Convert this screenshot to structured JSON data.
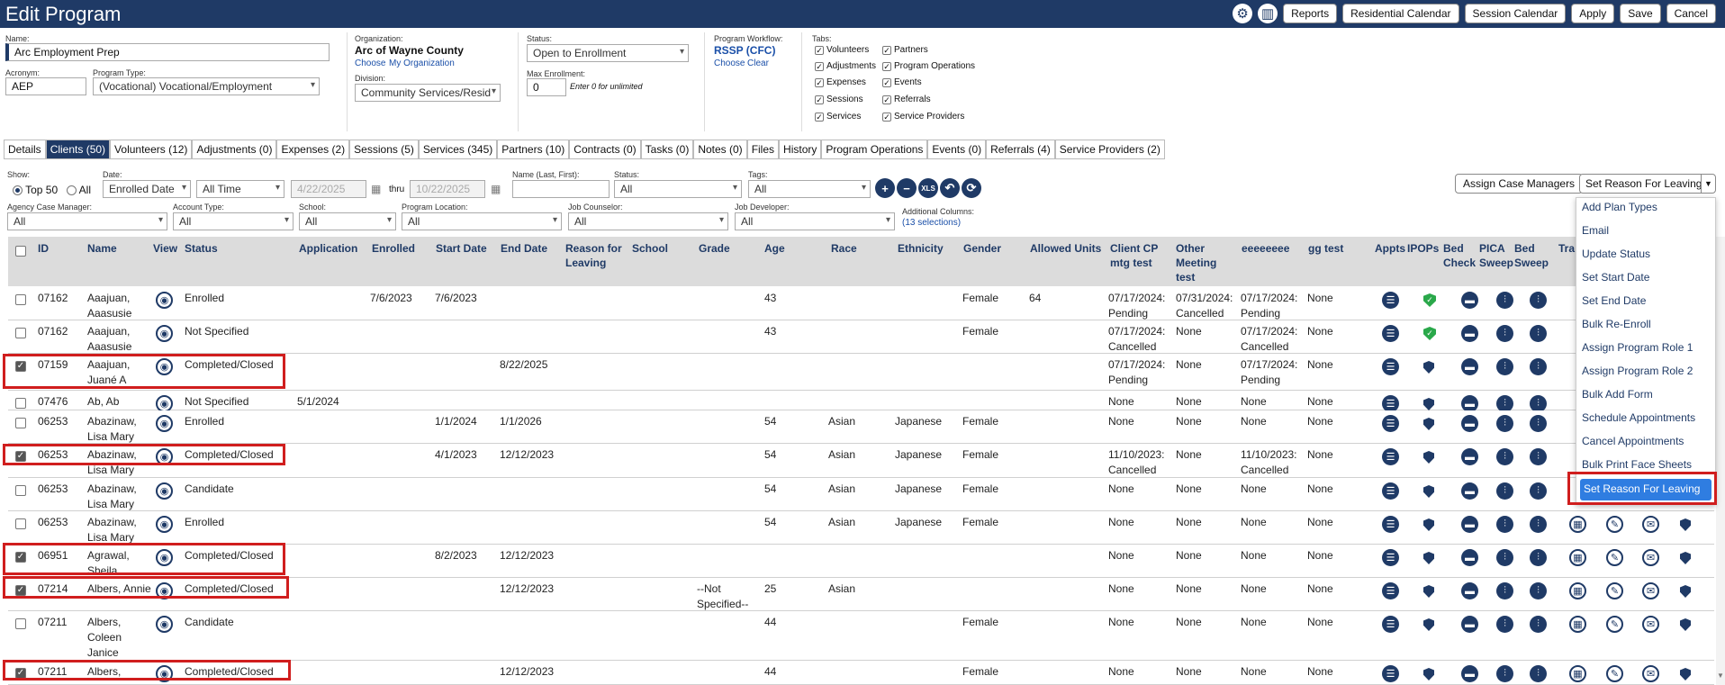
{
  "header": {
    "title": "Edit Program",
    "buttons": [
      "Reports",
      "Residential Calendar",
      "Session Calendar",
      "Apply",
      "Save",
      "Cancel"
    ]
  },
  "form": {
    "name_label": "Name:",
    "name_value": "Arc Employment Prep",
    "acronym_label": "Acronym:",
    "acronym_value": "AEP",
    "program_type_label": "Program Type:",
    "program_type_value": "(Vocational) Vocational/Employment",
    "org_label": "Organization:",
    "org_value": "Arc of Wayne County",
    "org_choose": "Choose",
    "org_mine": "My Organization",
    "division_label": "Division:",
    "division_value": "Community Services/Resid",
    "status_label": "Status:",
    "status_value": "Open to Enrollment",
    "max_label": "Max Enrollment:",
    "max_value": "0",
    "max_hint": "Enter 0 for unlimited",
    "workflow_label": "Program Workflow:",
    "workflow_value": "RSSP (CFC)",
    "workflow_choose": "Choose",
    "workflow_clear": "Clear",
    "tabs_label": "Tabs:",
    "tab_checks": [
      "Volunteers",
      "Adjustments",
      "Expenses",
      "Sessions",
      "Services",
      "Partners",
      "Program Operations",
      "Events",
      "Referrals",
      "Service Providers"
    ]
  },
  "tabs": [
    "Details",
    "Clients (50)",
    "Volunteers (12)",
    "Adjustments (0)",
    "Expenses (2)",
    "Sessions (5)",
    "Services (345)",
    "Partners (10)",
    "Contracts (0)",
    "Tasks (0)",
    "Notes (0)",
    "Files",
    "History",
    "Program Operations",
    "Events (0)",
    "Referrals (4)",
    "Service Providers (2)"
  ],
  "filters": {
    "show_label": "Show:",
    "top50": "Top 50",
    "all": "All",
    "date_label": "Date:",
    "date_value": "Enrolled Date",
    "range_value": "All Time",
    "from_date": "4/22/2025",
    "thru": "thru",
    "to_date": "10/22/2025",
    "name_label": "Name (Last, First):",
    "status_label": "Status:",
    "status_value": "All",
    "tags_label": "Tags:",
    "tags_value": "All",
    "xls": "XLS",
    "agency_cm_label": "Agency Case Manager:",
    "agency_cm_value": "All",
    "account_type_label": "Account Type:",
    "account_type_value": "All",
    "school_label": "School:",
    "school_value": "All",
    "location_label": "Program Location:",
    "location_value": "All",
    "job_counselor_label": "Job Counselor:",
    "job_counselor_value": "All",
    "job_developer_label": "Job Developer:",
    "job_developer_value": "All",
    "addl_label": "Additional Columns:",
    "addl_value": "(13 selections)",
    "assign_cm": "Assign Case Managers",
    "set_reason": "Set Reason For Leaving"
  },
  "columns": [
    "ID",
    "Name",
    "View",
    "Status",
    "Application",
    "Enrolled",
    "Start Date",
    "End Date",
    "Reason for Leaving",
    "School",
    "Grade",
    "Age",
    "Race",
    "Ethnicity",
    "Gender",
    "Allowed Units",
    "Client CP mtg test",
    "Other Meeting test",
    "eeeeeeee",
    "gg test",
    "Appts",
    "IPOPs",
    "Bed Check",
    "PICA Sweep",
    "Bed Sweep",
    "Tra"
  ],
  "rows": [
    {
      "checked": false,
      "id": "07162",
      "name": "Aaajuan, Aaasusie",
      "status": "Enrolled",
      "application": "",
      "enrolled": "7/6/2023",
      "start": "7/6/2023",
      "end": "",
      "grade": "",
      "age": "43",
      "race": "",
      "ethnicity": "",
      "gender": "Female",
      "units": "64",
      "cp": "07/17/2024: Pending",
      "other": "07/31/2024: Cancelled",
      "eee": "07/17/2024: Pending",
      "gg": "None",
      "ipop_ok": true
    },
    {
      "checked": false,
      "id": "07162",
      "name": "Aaajuan, Aaasusie",
      "status": "Not Specified",
      "application": "",
      "enrolled": "",
      "start": "",
      "end": "",
      "grade": "",
      "age": "43",
      "race": "",
      "ethnicity": "",
      "gender": "Female",
      "units": "",
      "cp": "07/17/2024: Cancelled",
      "other": "None",
      "eee": "07/17/2024: Cancelled",
      "gg": "None",
      "ipop_ok": true
    },
    {
      "checked": true,
      "id": "07159",
      "name": "Aaajuan, Juané A",
      "status": "Completed/Closed",
      "application": "",
      "enrolled": "",
      "start": "",
      "end": "8/22/2025",
      "grade": "",
      "age": "",
      "race": "",
      "ethnicity": "",
      "gender": "",
      "units": "",
      "cp": "07/17/2024: Pending",
      "other": "None",
      "eee": "07/17/2024: Pending",
      "gg": "None",
      "ipop_ok": false
    },
    {
      "checked": false,
      "id": "07476",
      "name": "Ab, Ab",
      "status": "Not Specified",
      "application": "5/1/2024",
      "enrolled": "",
      "start": "",
      "end": "",
      "grade": "",
      "age": "",
      "race": "",
      "ethnicity": "",
      "gender": "",
      "units": "",
      "cp": "None",
      "other": "None",
      "eee": "None",
      "gg": "None",
      "ipop_ok": false
    },
    {
      "checked": false,
      "id": "06253",
      "name": "Abazinaw, Lisa Mary",
      "status": "Enrolled",
      "application": "",
      "enrolled": "",
      "start": "1/1/2024",
      "end": "1/1/2026",
      "grade": "",
      "age": "54",
      "race": "Asian",
      "ethnicity": "Japanese",
      "gender": "Female",
      "units": "",
      "cp": "None",
      "other": "None",
      "eee": "None",
      "gg": "None",
      "ipop_ok": false
    },
    {
      "checked": true,
      "id": "06253",
      "name": "Abazinaw, Lisa Mary",
      "status": "Completed/Closed",
      "application": "",
      "enrolled": "",
      "start": "4/1/2023",
      "end": "12/12/2023",
      "grade": "",
      "age": "54",
      "race": "Asian",
      "ethnicity": "Japanese",
      "gender": "Female",
      "units": "",
      "cp": "11/10/2023: Cancelled",
      "other": "None",
      "eee": "11/10/2023: Cancelled",
      "gg": "None",
      "ipop_ok": false
    },
    {
      "checked": false,
      "id": "06253",
      "name": "Abazinaw, Lisa Mary",
      "status": "Candidate",
      "application": "",
      "enrolled": "",
      "start": "",
      "end": "",
      "grade": "",
      "age": "54",
      "race": "Asian",
      "ethnicity": "Japanese",
      "gender": "Female",
      "units": "",
      "cp": "None",
      "other": "None",
      "eee": "None",
      "gg": "None",
      "ipop_ok": false
    },
    {
      "checked": false,
      "id": "06253",
      "name": "Abazinaw, Lisa Mary",
      "status": "Enrolled",
      "application": "",
      "enrolled": "",
      "start": "",
      "end": "",
      "grade": "",
      "age": "54",
      "race": "Asian",
      "ethnicity": "Japanese",
      "gender": "Female",
      "units": "",
      "cp": "None",
      "other": "None",
      "eee": "None",
      "gg": "None",
      "ipop_ok": false
    },
    {
      "checked": true,
      "id": "06951",
      "name": "Agrawal, Sheila",
      "status": "Completed/Closed",
      "application": "",
      "enrolled": "",
      "start": "8/2/2023",
      "end": "12/12/2023",
      "grade": "",
      "age": "",
      "race": "",
      "ethnicity": "",
      "gender": "",
      "units": "",
      "cp": "None",
      "other": "None",
      "eee": "None",
      "gg": "None",
      "ipop_ok": false
    },
    {
      "checked": true,
      "id": "07214",
      "name": "Albers, Annie",
      "status": "Completed/Closed",
      "application": "",
      "enrolled": "",
      "start": "",
      "end": "12/12/2023",
      "grade": "--Not Specified--",
      "age": "25",
      "race": "Asian",
      "ethnicity": "",
      "gender": "",
      "units": "",
      "cp": "None",
      "other": "None",
      "eee": "None",
      "gg": "None",
      "ipop_ok": false
    },
    {
      "checked": false,
      "id": "07211",
      "name": "Albers, Coleen Janice",
      "status": "Candidate",
      "application": "",
      "enrolled": "",
      "start": "",
      "end": "",
      "grade": "",
      "age": "44",
      "race": "",
      "ethnicity": "",
      "gender": "Female",
      "units": "",
      "cp": "None",
      "other": "None",
      "eee": "None",
      "gg": "None",
      "ipop_ok": false
    },
    {
      "checked": true,
      "id": "07211",
      "name": "Albers,",
      "status": "Completed/Closed",
      "application": "",
      "enrolled": "",
      "start": "",
      "end": "12/12/2023",
      "grade": "",
      "age": "44",
      "race": "",
      "ethnicity": "",
      "gender": "Female",
      "units": "",
      "cp": "None",
      "other": "None",
      "eee": "None",
      "gg": "None",
      "ipop_ok": false
    }
  ],
  "dropdown": {
    "items": [
      "Add Plan Types",
      "Email",
      "Update Status",
      "Set Start Date",
      "Set End Date",
      "Bulk Re-Enroll",
      "Assign Program Role 1",
      "Assign Program Role 2",
      "Bulk Add Form",
      "Schedule Appointments",
      "Cancel Appointments",
      "Bulk Print Face Sheets"
    ],
    "selected": "Set Reason For Leaving"
  }
}
